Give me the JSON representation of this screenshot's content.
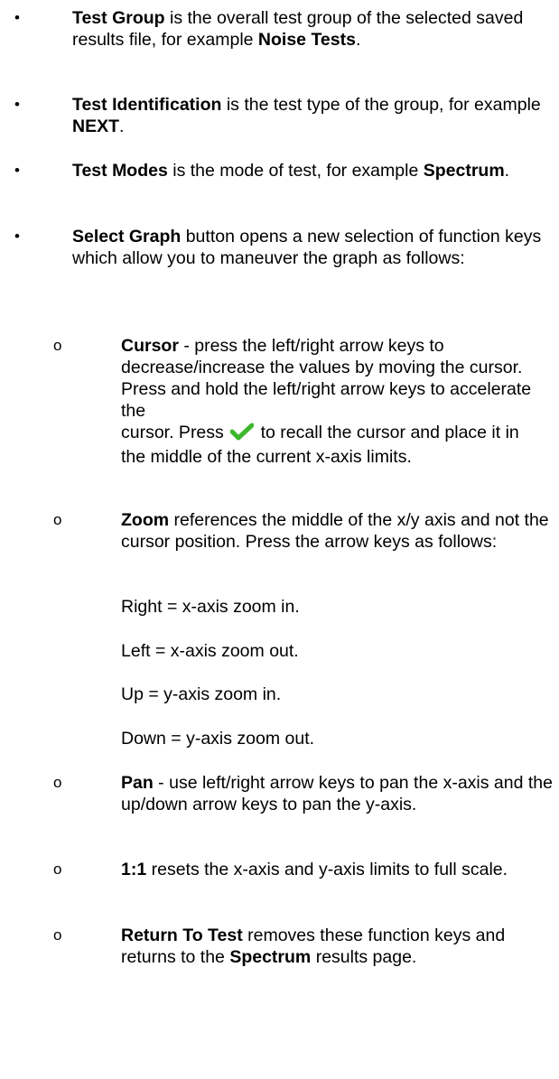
{
  "bullets": [
    {
      "term": "Test Group",
      "text": " is the overall test group of the selected saved results file, for example ",
      "example": "Noise Tests",
      "end": "."
    },
    {
      "term": "Test Identification",
      "text": " is the test type of the group, for example ",
      "example": "NEXT",
      "end": "."
    },
    {
      "term": "Test Modes",
      "text": " is the mode of test, for example ",
      "example": "Spectrum",
      "end": "."
    },
    {
      "term": "Select Graph",
      "text": " button opens a new selection of function keys which allow you to maneuver the graph as follows:"
    }
  ],
  "sub": {
    "cursor": {
      "term": "Cursor",
      "text_a": " - press the left/right arrow keys to decrease/increase the values by moving the cursor. Press and hold the left/right arrow keys to accelerate the",
      "text_b": "cursor. Press ",
      "text_c": " to recall the cursor and place it in the middle of the current x-axis limits."
    },
    "zoom": {
      "term": "Zoom",
      "text": " references the middle of the x/y axis and not the cursor position. Press the arrow keys as follows:",
      "lines": [
        "Right = x-axis zoom in.",
        "Left = x-axis zoom out.",
        "Up = y-axis zoom in.",
        "Down = y-axis zoom out."
      ]
    },
    "pan": {
      "term": "Pan",
      "text": " - use left/right arrow keys to pan the x-axis and the up/down arrow keys to pan the y-axis."
    },
    "one": {
      "term": "1:1",
      "text": " resets the x-axis and y-axis limits to full scale."
    },
    "ret": {
      "term": "Return To Test",
      "text": " removes these function keys and returns to the ",
      "example": "Spectrum",
      "end": " results page."
    }
  },
  "icons": {
    "bullet": "•",
    "sub_bullet": "o",
    "check": "checkmark-icon",
    "check_color": "#3db82c"
  }
}
